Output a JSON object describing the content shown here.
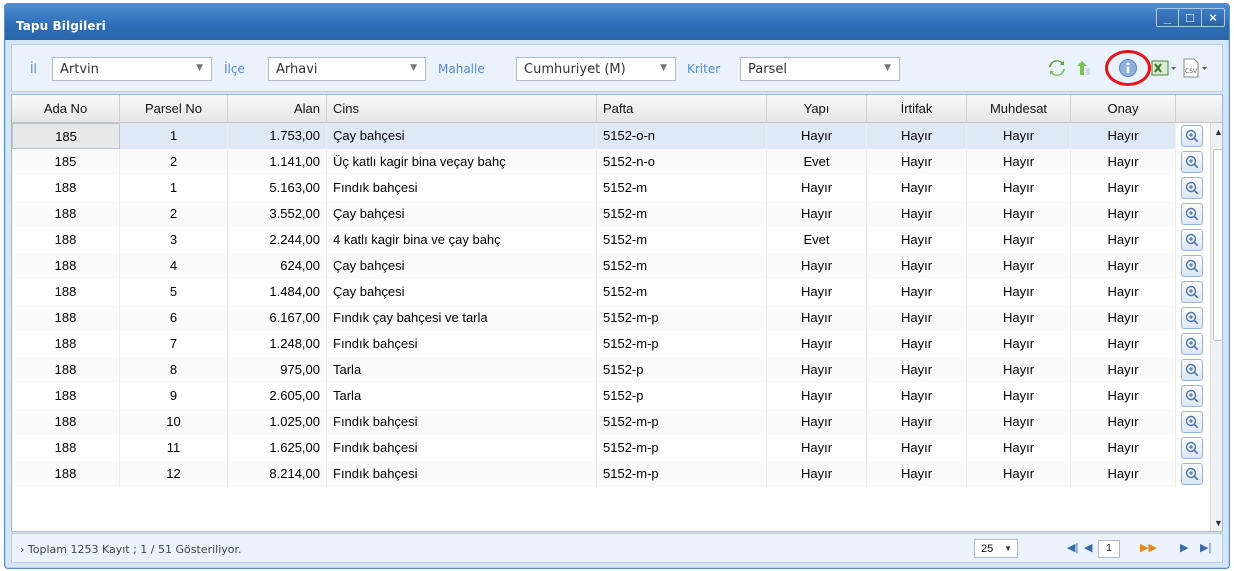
{
  "window": {
    "title": "Tapu Bilgileri",
    "controls": {
      "minimize": "_",
      "maximize": "□",
      "close": "×"
    }
  },
  "filters": {
    "il": {
      "label": "İl",
      "value": "Artvin"
    },
    "ilce": {
      "label": "İlçe",
      "value": "Arhavi"
    },
    "mahalle": {
      "label": "Mahalle",
      "value": "Cumhuriyet (M)"
    },
    "kriter": {
      "label": "Kriter",
      "value": "Parsel"
    }
  },
  "toolbar_icons": [
    "refresh-icon",
    "upload-icon",
    "info-icon",
    "excel-export-icon",
    "csv-export-icon"
  ],
  "grid": {
    "columns": [
      "Ada No",
      "Parsel No",
      "Alan",
      "Cins",
      "Pafta",
      "Yapı",
      "İrtifak",
      "Muhdesat",
      "Onay"
    ],
    "rows": [
      [
        "185",
        "1",
        "1.753,00",
        "Çay bahçesi",
        "5152-o-n",
        "Hayır",
        "Hayır",
        "Hayır",
        "Hayır"
      ],
      [
        "185",
        "2",
        "1.141,00",
        "Üç katlı kagir bina veçay bahç",
        "5152-n-o",
        "Evet",
        "Hayır",
        "Hayır",
        "Hayır"
      ],
      [
        "188",
        "1",
        "5.163,00",
        "Fındık bahçesi",
        "5152-m",
        "Hayır",
        "Hayır",
        "Hayır",
        "Hayır"
      ],
      [
        "188",
        "2",
        "3.552,00",
        "Çay bahçesi",
        "5152-m",
        "Hayır",
        "Hayır",
        "Hayır",
        "Hayır"
      ],
      [
        "188",
        "3",
        "2.244,00",
        "4 katlı kagir bina ve çay bahç",
        "5152-m",
        "Evet",
        "Hayır",
        "Hayır",
        "Hayır"
      ],
      [
        "188",
        "4",
        "624,00",
        "Çay bahçesi",
        "5152-m",
        "Hayır",
        "Hayır",
        "Hayır",
        "Hayır"
      ],
      [
        "188",
        "5",
        "1.484,00",
        "Çay bahçesi",
        "5152-m",
        "Hayır",
        "Hayır",
        "Hayır",
        "Hayır"
      ],
      [
        "188",
        "6",
        "6.167,00",
        "Fındık çay bahçesi ve tarla",
        "5152-m-p",
        "Hayır",
        "Hayır",
        "Hayır",
        "Hayır"
      ],
      [
        "188",
        "7",
        "1.248,00",
        "Fındık bahçesi",
        "5152-m-p",
        "Hayır",
        "Hayır",
        "Hayır",
        "Hayır"
      ],
      [
        "188",
        "8",
        "975,00",
        "Tarla",
        "5152-p",
        "Hayır",
        "Hayır",
        "Hayır",
        "Hayır"
      ],
      [
        "188",
        "9",
        "2.605,00",
        "Tarla",
        "5152-p",
        "Hayır",
        "Hayır",
        "Hayır",
        "Hayır"
      ],
      [
        "188",
        "10",
        "1.025,00",
        "Fındık bahçesi",
        "5152-m-p",
        "Hayır",
        "Hayır",
        "Hayır",
        "Hayır"
      ],
      [
        "188",
        "11",
        "1.625,00",
        "Fındık bahçesi",
        "5152-m-p",
        "Hayır",
        "Hayır",
        "Hayır",
        "Hayır"
      ],
      [
        "188",
        "12",
        "8.214,00",
        "Fındık bahçesi",
        "5152-m-p",
        "Hayır",
        "Hayır",
        "Hayır",
        "Hayır"
      ]
    ],
    "selected_row": 0
  },
  "pager": {
    "info": "Toplam 1253 Kayıt ; 1 / 51 Gösteriliyor.",
    "page_size": "25",
    "current_page": "1"
  },
  "colors": {
    "title_bar": "#2f6fb8",
    "filter_label": "#5b8ad0",
    "highlight_ring": "#e8141b"
  }
}
